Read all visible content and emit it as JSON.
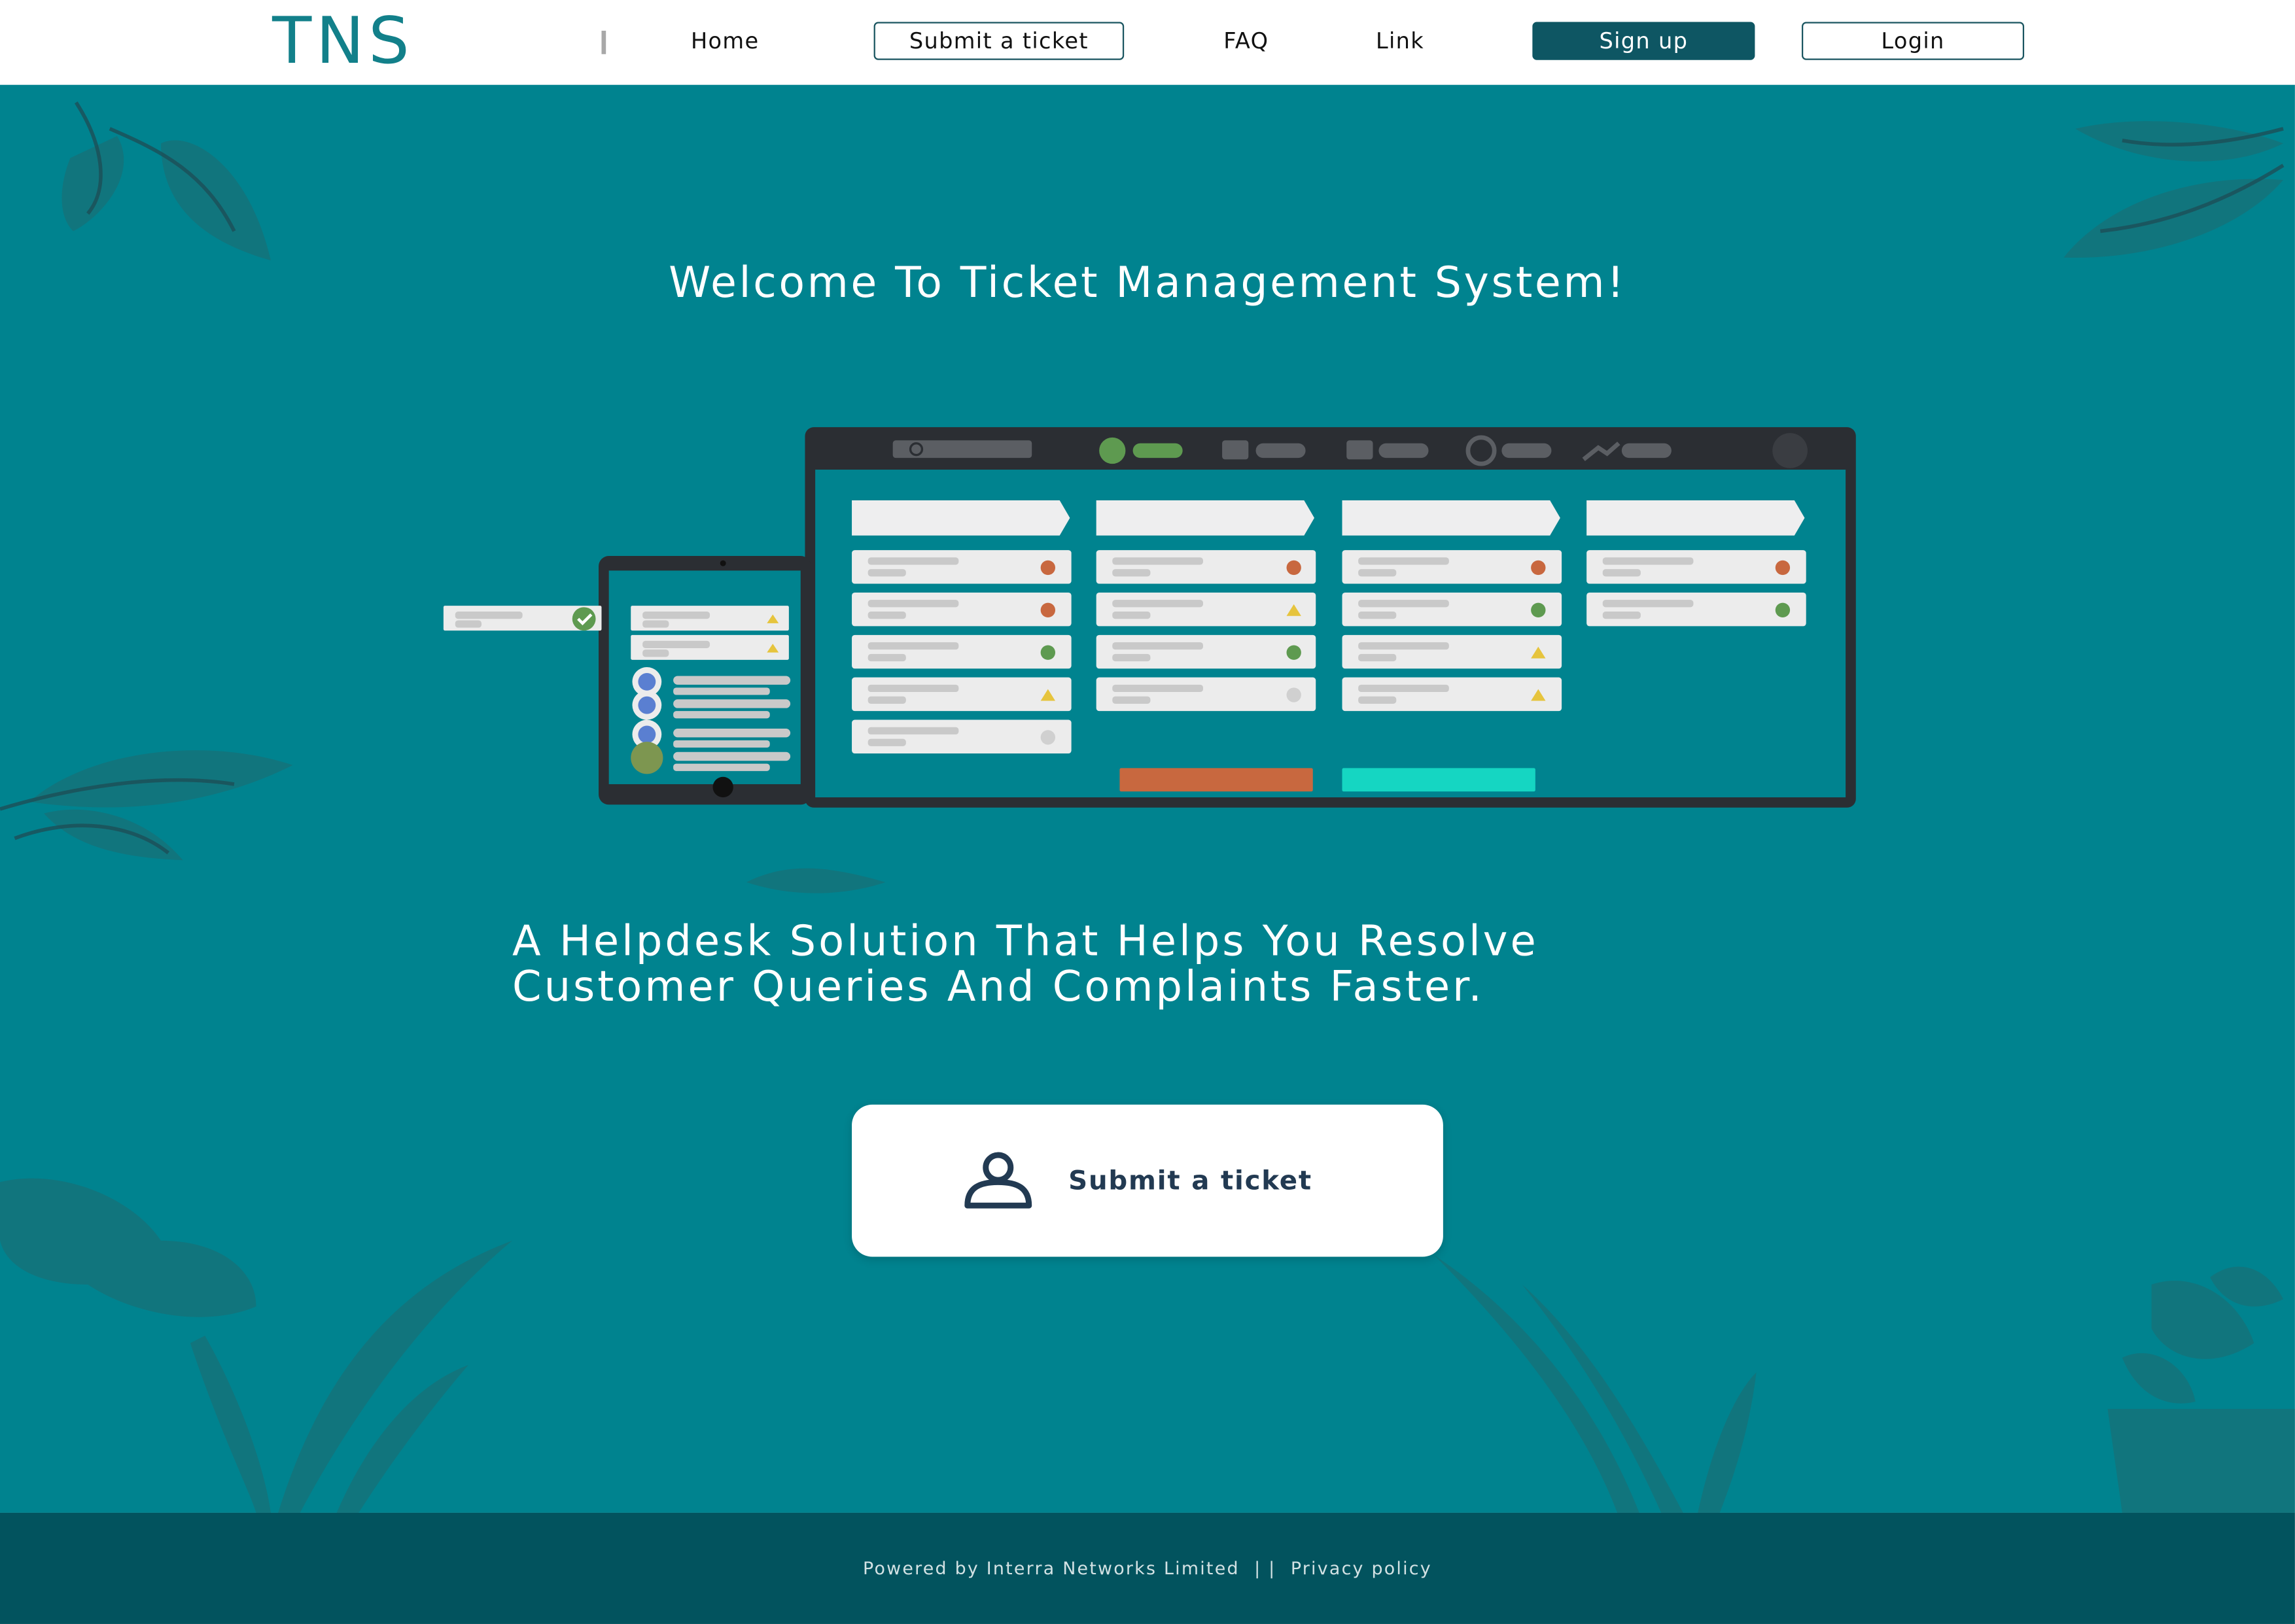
{
  "header": {
    "logo": "TNS",
    "nav": {
      "home": "Home",
      "submit_ticket": "Submit a ticket",
      "faq": "FAQ",
      "link": "Link",
      "sign_up": "Sign up",
      "login": "Login"
    }
  },
  "hero": {
    "title": "Welcome To Ticket Management System!",
    "tagline_line1": "A Helpdesk Solution That Helps You Resolve",
    "tagline_line2": "Customer Queries And Complaints Faster.",
    "cta_label": "Submit a ticket"
  },
  "footer": {
    "powered_by": "Powered by Interra Networks Limited",
    "separator": "| |",
    "privacy": "Privacy policy"
  },
  "colors": {
    "brand": "#12808a",
    "hero_bg": "#00838f",
    "nav_dark": "#0e5663",
    "footer_bg": "#02535e",
    "status_red": "#c8683f",
    "status_green": "#5e9a50",
    "status_yellow": "#e6c43d"
  },
  "icons": {
    "cta": "user-icon",
    "illustration": "helpdesk-dashboard-illustration"
  }
}
